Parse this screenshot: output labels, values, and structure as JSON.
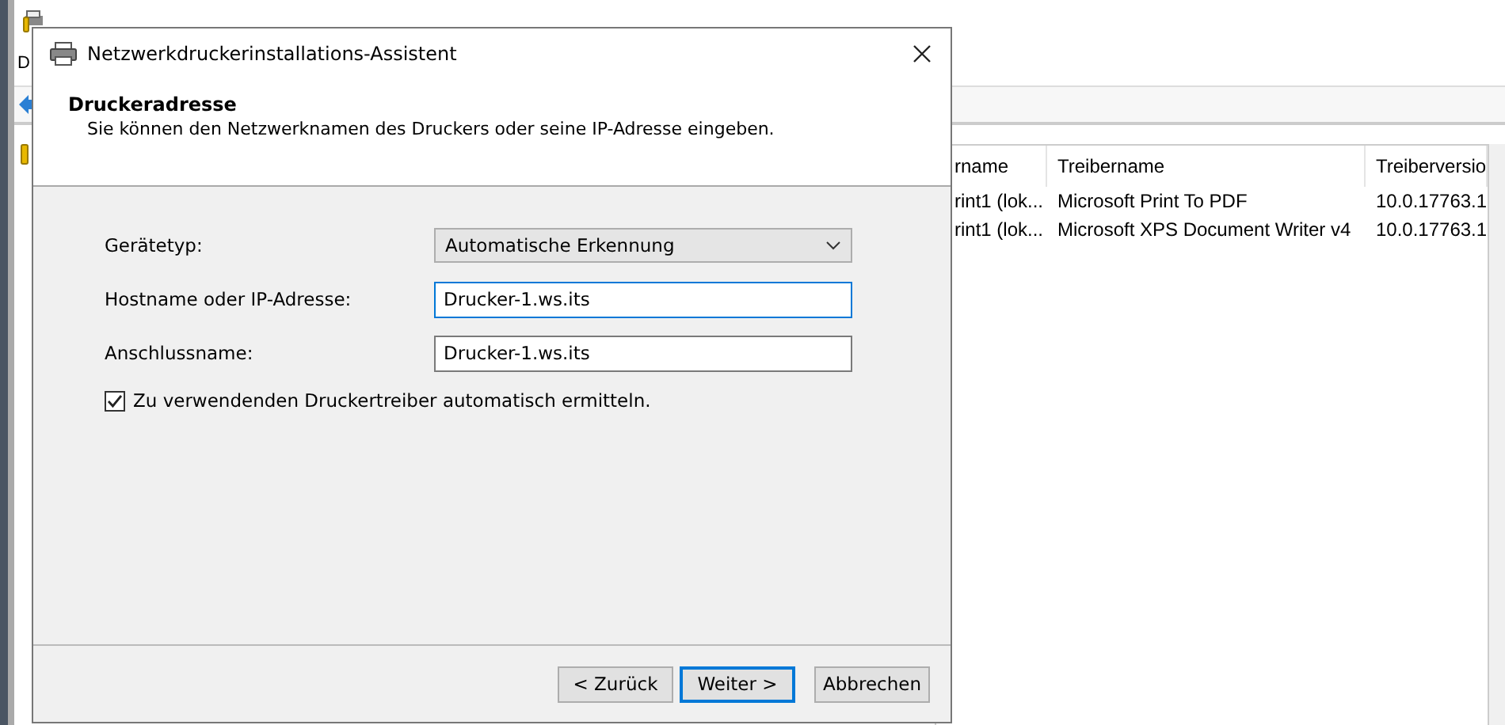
{
  "background_window": {
    "menu": [
      "D"
    ],
    "list": {
      "columns": [
        "rname",
        "Treibername",
        "Treiberversio"
      ],
      "rows": [
        [
          "rint1 (lok...",
          "Microsoft Print To PDF",
          "10.0.17763.1"
        ],
        [
          "rint1 (lok...",
          "Microsoft XPS Document Writer v4",
          "10.0.17763.1"
        ]
      ]
    }
  },
  "dialog": {
    "title": "Netzwerkdruckerinstallations-Assistent",
    "heading": "Druckeradresse",
    "subtitle": "Sie können den Netzwerknamen des Druckers oder seine IP-Adresse eingeben.",
    "fields": [
      {
        "kind": "dropdown",
        "label": "Gerätetyp:",
        "value": "Automatische Erkennung",
        "focused": false
      },
      {
        "kind": "text",
        "label": "Hostname oder IP-Adresse:",
        "value": "Drucker-1.ws.its",
        "focused": true
      },
      {
        "kind": "text",
        "label": "Anschlussname:",
        "value": "Drucker-1.ws.its",
        "focused": false
      }
    ],
    "checkbox": {
      "label": "Zu verwendenden Druckertreiber automatisch ermitteln.",
      "checked": true
    },
    "buttons": [
      {
        "label": "< Zurück",
        "default": false
      },
      {
        "label": "Weiter >",
        "default": true
      },
      {
        "label": "Abbrechen",
        "default": false
      }
    ]
  }
}
